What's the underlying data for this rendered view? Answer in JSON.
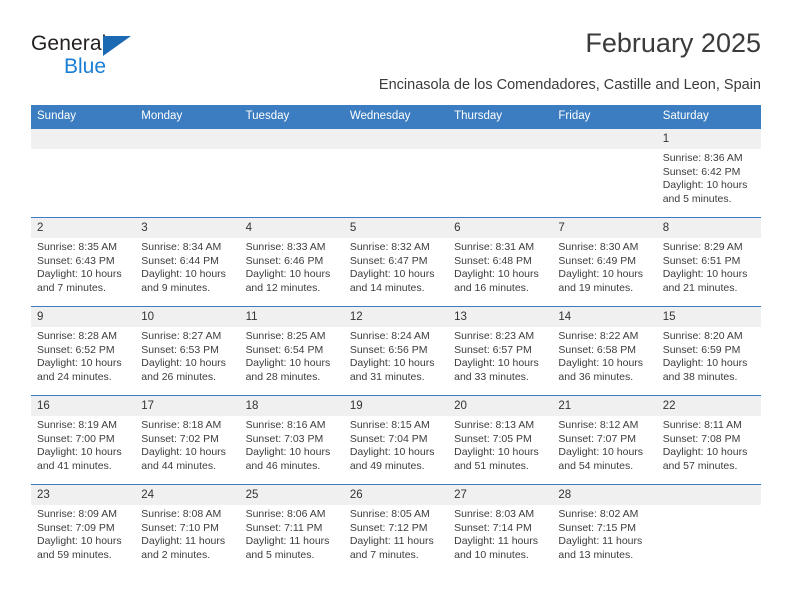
{
  "brand": {
    "name_part1": "General",
    "name_part2": "Blue",
    "triangle_icon": "triangle-icon",
    "accent_color": "#1b7ed6"
  },
  "header": {
    "title": "February 2025",
    "subtitle": "Encinasola de los Comendadores, Castille and Leon, Spain"
  },
  "theme": {
    "header_blue": "#3b7dc0",
    "daynum_band": "#f0f0f0",
    "text": "#3d3d3d"
  },
  "calendar": {
    "weekday_headers": [
      "Sunday",
      "Monday",
      "Tuesday",
      "Wednesday",
      "Thursday",
      "Friday",
      "Saturday"
    ],
    "weeks": [
      {
        "days": [
          {
            "num": "",
            "sunrise": "",
            "sunset": "",
            "daylight1": "",
            "daylight2": ""
          },
          {
            "num": "",
            "sunrise": "",
            "sunset": "",
            "daylight1": "",
            "daylight2": ""
          },
          {
            "num": "",
            "sunrise": "",
            "sunset": "",
            "daylight1": "",
            "daylight2": ""
          },
          {
            "num": "",
            "sunrise": "",
            "sunset": "",
            "daylight1": "",
            "daylight2": ""
          },
          {
            "num": "",
            "sunrise": "",
            "sunset": "",
            "daylight1": "",
            "daylight2": ""
          },
          {
            "num": "",
            "sunrise": "",
            "sunset": "",
            "daylight1": "",
            "daylight2": ""
          },
          {
            "num": "1",
            "sunrise": "Sunrise: 8:36 AM",
            "sunset": "Sunset: 6:42 PM",
            "daylight1": "Daylight: 10 hours",
            "daylight2": "and 5 minutes."
          }
        ]
      },
      {
        "days": [
          {
            "num": "2",
            "sunrise": "Sunrise: 8:35 AM",
            "sunset": "Sunset: 6:43 PM",
            "daylight1": "Daylight: 10 hours",
            "daylight2": "and 7 minutes."
          },
          {
            "num": "3",
            "sunrise": "Sunrise: 8:34 AM",
            "sunset": "Sunset: 6:44 PM",
            "daylight1": "Daylight: 10 hours",
            "daylight2": "and 9 minutes."
          },
          {
            "num": "4",
            "sunrise": "Sunrise: 8:33 AM",
            "sunset": "Sunset: 6:46 PM",
            "daylight1": "Daylight: 10 hours",
            "daylight2": "and 12 minutes."
          },
          {
            "num": "5",
            "sunrise": "Sunrise: 8:32 AM",
            "sunset": "Sunset: 6:47 PM",
            "daylight1": "Daylight: 10 hours",
            "daylight2": "and 14 minutes."
          },
          {
            "num": "6",
            "sunrise": "Sunrise: 8:31 AM",
            "sunset": "Sunset: 6:48 PM",
            "daylight1": "Daylight: 10 hours",
            "daylight2": "and 16 minutes."
          },
          {
            "num": "7",
            "sunrise": "Sunrise: 8:30 AM",
            "sunset": "Sunset: 6:49 PM",
            "daylight1": "Daylight: 10 hours",
            "daylight2": "and 19 minutes."
          },
          {
            "num": "8",
            "sunrise": "Sunrise: 8:29 AM",
            "sunset": "Sunset: 6:51 PM",
            "daylight1": "Daylight: 10 hours",
            "daylight2": "and 21 minutes."
          }
        ]
      },
      {
        "days": [
          {
            "num": "9",
            "sunrise": "Sunrise: 8:28 AM",
            "sunset": "Sunset: 6:52 PM",
            "daylight1": "Daylight: 10 hours",
            "daylight2": "and 24 minutes."
          },
          {
            "num": "10",
            "sunrise": "Sunrise: 8:27 AM",
            "sunset": "Sunset: 6:53 PM",
            "daylight1": "Daylight: 10 hours",
            "daylight2": "and 26 minutes."
          },
          {
            "num": "11",
            "sunrise": "Sunrise: 8:25 AM",
            "sunset": "Sunset: 6:54 PM",
            "daylight1": "Daylight: 10 hours",
            "daylight2": "and 28 minutes."
          },
          {
            "num": "12",
            "sunrise": "Sunrise: 8:24 AM",
            "sunset": "Sunset: 6:56 PM",
            "daylight1": "Daylight: 10 hours",
            "daylight2": "and 31 minutes."
          },
          {
            "num": "13",
            "sunrise": "Sunrise: 8:23 AM",
            "sunset": "Sunset: 6:57 PM",
            "daylight1": "Daylight: 10 hours",
            "daylight2": "and 33 minutes."
          },
          {
            "num": "14",
            "sunrise": "Sunrise: 8:22 AM",
            "sunset": "Sunset: 6:58 PM",
            "daylight1": "Daylight: 10 hours",
            "daylight2": "and 36 minutes."
          },
          {
            "num": "15",
            "sunrise": "Sunrise: 8:20 AM",
            "sunset": "Sunset: 6:59 PM",
            "daylight1": "Daylight: 10 hours",
            "daylight2": "and 38 minutes."
          }
        ]
      },
      {
        "days": [
          {
            "num": "16",
            "sunrise": "Sunrise: 8:19 AM",
            "sunset": "Sunset: 7:00 PM",
            "daylight1": "Daylight: 10 hours",
            "daylight2": "and 41 minutes."
          },
          {
            "num": "17",
            "sunrise": "Sunrise: 8:18 AM",
            "sunset": "Sunset: 7:02 PM",
            "daylight1": "Daylight: 10 hours",
            "daylight2": "and 44 minutes."
          },
          {
            "num": "18",
            "sunrise": "Sunrise: 8:16 AM",
            "sunset": "Sunset: 7:03 PM",
            "daylight1": "Daylight: 10 hours",
            "daylight2": "and 46 minutes."
          },
          {
            "num": "19",
            "sunrise": "Sunrise: 8:15 AM",
            "sunset": "Sunset: 7:04 PM",
            "daylight1": "Daylight: 10 hours",
            "daylight2": "and 49 minutes."
          },
          {
            "num": "20",
            "sunrise": "Sunrise: 8:13 AM",
            "sunset": "Sunset: 7:05 PM",
            "daylight1": "Daylight: 10 hours",
            "daylight2": "and 51 minutes."
          },
          {
            "num": "21",
            "sunrise": "Sunrise: 8:12 AM",
            "sunset": "Sunset: 7:07 PM",
            "daylight1": "Daylight: 10 hours",
            "daylight2": "and 54 minutes."
          },
          {
            "num": "22",
            "sunrise": "Sunrise: 8:11 AM",
            "sunset": "Sunset: 7:08 PM",
            "daylight1": "Daylight: 10 hours",
            "daylight2": "and 57 minutes."
          }
        ]
      },
      {
        "days": [
          {
            "num": "23",
            "sunrise": "Sunrise: 8:09 AM",
            "sunset": "Sunset: 7:09 PM",
            "daylight1": "Daylight: 10 hours",
            "daylight2": "and 59 minutes."
          },
          {
            "num": "24",
            "sunrise": "Sunrise: 8:08 AM",
            "sunset": "Sunset: 7:10 PM",
            "daylight1": "Daylight: 11 hours",
            "daylight2": "and 2 minutes."
          },
          {
            "num": "25",
            "sunrise": "Sunrise: 8:06 AM",
            "sunset": "Sunset: 7:11 PM",
            "daylight1": "Daylight: 11 hours",
            "daylight2": "and 5 minutes."
          },
          {
            "num": "26",
            "sunrise": "Sunrise: 8:05 AM",
            "sunset": "Sunset: 7:12 PM",
            "daylight1": "Daylight: 11 hours",
            "daylight2": "and 7 minutes."
          },
          {
            "num": "27",
            "sunrise": "Sunrise: 8:03 AM",
            "sunset": "Sunset: 7:14 PM",
            "daylight1": "Daylight: 11 hours",
            "daylight2": "and 10 minutes."
          },
          {
            "num": "28",
            "sunrise": "Sunrise: 8:02 AM",
            "sunset": "Sunset: 7:15 PM",
            "daylight1": "Daylight: 11 hours",
            "daylight2": "and 13 minutes."
          },
          {
            "num": "",
            "sunrise": "",
            "sunset": "",
            "daylight1": "",
            "daylight2": ""
          }
        ]
      }
    ]
  }
}
